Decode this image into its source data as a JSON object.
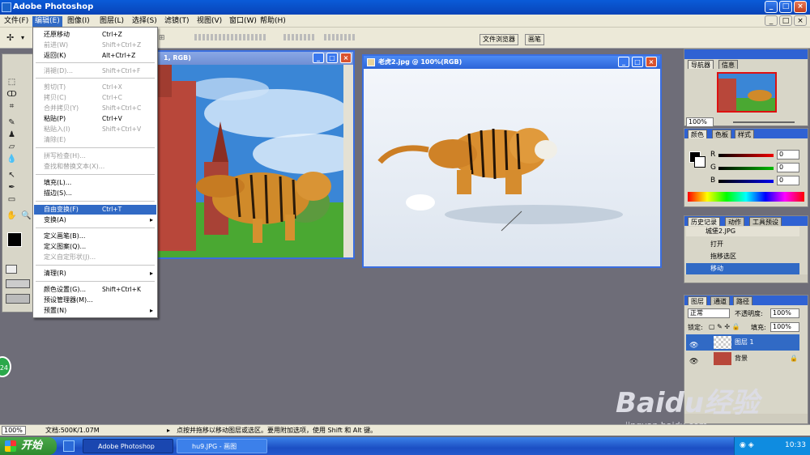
{
  "window": {
    "title": "Adobe Photoshop",
    "min": "_",
    "max": "□",
    "close": "×"
  },
  "menubar": {
    "items": [
      "文件(F)",
      "编辑(E)",
      "图像(I)",
      "图层(L)",
      "选择(S)",
      "滤镜(T)",
      "视图(V)",
      "窗口(W)",
      "帮助(H)"
    ]
  },
  "options": {
    "file_browser_tab": "文件浏览器",
    "brushes_tab": "画笔"
  },
  "edit_menu": {
    "items": [
      {
        "label": "还原移动",
        "shortcut": "Ctrl+Z",
        "disabled": false
      },
      {
        "label": "前进(W)",
        "shortcut": "Shift+Ctrl+Z",
        "disabled": true
      },
      {
        "label": "返回(K)",
        "shortcut": "Alt+Ctrl+Z",
        "disabled": false
      },
      {
        "label": "消褪(D)...",
        "shortcut": "Shift+Ctrl+F",
        "disabled": true
      },
      {
        "label": "剪切(T)",
        "shortcut": "Ctrl+X",
        "disabled": true
      },
      {
        "label": "拷贝(C)",
        "shortcut": "Ctrl+C",
        "disabled": true
      },
      {
        "label": "合并拷贝(Y)",
        "shortcut": "Shift+Ctrl+C",
        "disabled": true
      },
      {
        "label": "粘贴(P)",
        "shortcut": "Ctrl+V",
        "disabled": false
      },
      {
        "label": "粘贴入(I)",
        "shortcut": "Shift+Ctrl+V",
        "disabled": true
      },
      {
        "label": "清除(E)",
        "shortcut": "",
        "disabled": true
      },
      {
        "label": "拼写检查(H)...",
        "shortcut": "",
        "disabled": true
      },
      {
        "label": "查找和替换文本(X)...",
        "shortcut": "",
        "disabled": true
      },
      {
        "label": "填充(L)...",
        "shortcut": "",
        "disabled": false
      },
      {
        "label": "描边(S)...",
        "shortcut": "",
        "disabled": false
      },
      {
        "label": "自由变换(F)",
        "shortcut": "Ctrl+T",
        "disabled": false,
        "highlighted": true
      },
      {
        "label": "变换(A)",
        "shortcut": "",
        "disabled": false,
        "submenu": true
      },
      {
        "label": "定义画笔(B)...",
        "shortcut": "",
        "disabled": false
      },
      {
        "label": "定义图案(Q)...",
        "shortcut": "",
        "disabled": false
      },
      {
        "label": "定义自定形状(J)...",
        "shortcut": "",
        "disabled": true
      },
      {
        "label": "清理(R)",
        "shortcut": "",
        "disabled": false,
        "submenu": true
      },
      {
        "label": "颜色设置(G)...",
        "shortcut": "Shift+Ctrl+K",
        "disabled": false
      },
      {
        "label": "预设管理器(M)...",
        "shortcut": "",
        "disabled": false
      },
      {
        "label": "预置(N)",
        "shortcut": "",
        "disabled": false,
        "submenu": true
      }
    ]
  },
  "doc1": {
    "title": "1, RGB)"
  },
  "doc2": {
    "title": "老虎2.jpg @ 100%(RGB)"
  },
  "navigator": {
    "tabs": [
      "导航器",
      "信息"
    ],
    "zoom": "100%"
  },
  "color": {
    "tabs": [
      "颜色",
      "色板",
      "样式"
    ],
    "r_label": "R",
    "g_label": "G",
    "b_label": "B",
    "r": "0",
    "g": "0",
    "b": "0"
  },
  "history": {
    "tabs": [
      "历史记录",
      "动作",
      "工具预设"
    ],
    "snapshot": "城堡2.JPG",
    "items": [
      "打开",
      "拖移选区",
      "移动"
    ]
  },
  "layers": {
    "tabs": [
      "图层",
      "通道",
      "路径"
    ],
    "blend_mode": "正常",
    "opacity_label": "不透明度:",
    "opacity": "100%",
    "lock_label": "锁定:",
    "fill_label": "填充:",
    "fill": "100%",
    "items": [
      "图层 1",
      "背景"
    ]
  },
  "status": {
    "zoom": "100%",
    "doc_size": "文档:500K/1.07M",
    "hint": "点按并拖移以移动图层或选区。要用附加选项，使用 Shift 和 Alt 键。"
  },
  "taskbar": {
    "start": "开始",
    "tasks": [
      "Adobe Photoshop",
      "hu9.JPG - 画图"
    ],
    "clock": "10:33"
  },
  "badge": {
    "text": "24"
  },
  "watermark": {
    "text": "Baidu经验",
    "url": "jingyan.baidu.com"
  }
}
